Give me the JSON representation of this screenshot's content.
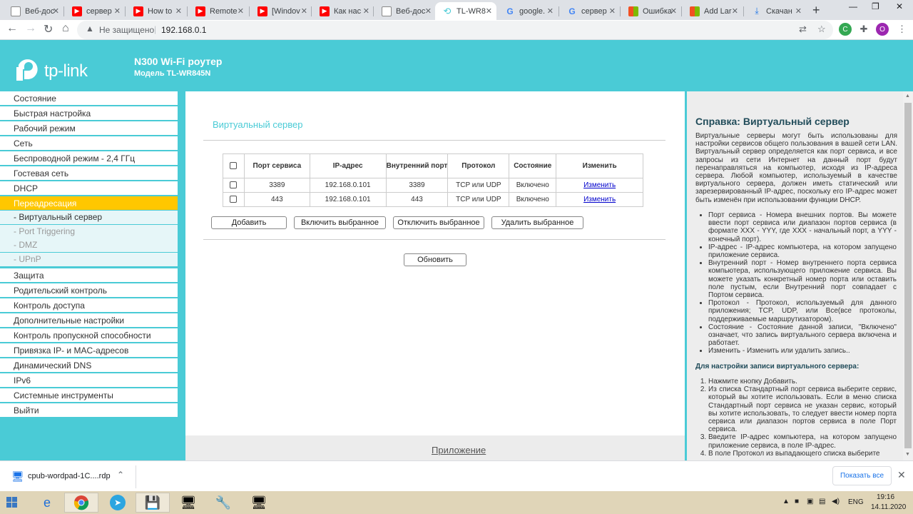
{
  "browser": {
    "tabs": [
      {
        "title": "Веб-дос",
        "icon": "edge-icon"
      },
      {
        "title": "сервер",
        "icon": "youtube-icon"
      },
      {
        "title": "How to",
        "icon": "youtube-icon"
      },
      {
        "title": "Remote",
        "icon": "youtube-icon"
      },
      {
        "title": "[Windov",
        "icon": "youtube-icon"
      },
      {
        "title": "Как нас",
        "icon": "youtube-icon"
      },
      {
        "title": "Веб-дос",
        "icon": "edge-icon"
      },
      {
        "title": "TL-WR8",
        "icon": "tplink-icon"
      },
      {
        "title": "google.",
        "icon": "google-icon"
      },
      {
        "title": "сервер",
        "icon": "google-icon"
      },
      {
        "title": "Ошибка",
        "icon": "microsoft-icon"
      },
      {
        "title": "Add Lar",
        "icon": "microsoft-icon"
      },
      {
        "title": "Скачан",
        "icon": "download-icon"
      }
    ],
    "security_label": "Не защищено",
    "url": "192.168.0.1",
    "profile_initial": "O"
  },
  "router": {
    "logo_text": "tp-link",
    "product_title": "N300 Wi-Fi роутер",
    "model_subtitle": "Модель TL-WR845N"
  },
  "menu": [
    {
      "label": "Состояние"
    },
    {
      "label": "Быстрая настройка"
    },
    {
      "label": "Рабочий режим"
    },
    {
      "label": "Сеть"
    },
    {
      "label": "Беспроводной режим - 2,4 ГГц"
    },
    {
      "label": "Гостевая сеть"
    },
    {
      "label": "DHCP"
    },
    {
      "label": "Переадресация"
    }
  ],
  "submenu": [
    {
      "label": "- Виртуальный сервер"
    },
    {
      "label": "- Port Triggering"
    },
    {
      "label": "- DMZ"
    },
    {
      "label": "- UPnP"
    }
  ],
  "menu_after": [
    {
      "label": "Защита"
    },
    {
      "label": "Родительский контроль"
    },
    {
      "label": "Контроль доступа"
    },
    {
      "label": "Дополнительные настройки маршрутизации"
    },
    {
      "label": "Контроль пропускной способности"
    },
    {
      "label": "Привязка IP- и MAC-адресов"
    },
    {
      "label": "Динамический DNS"
    },
    {
      "label": "IPv6"
    },
    {
      "label": "Системные инструменты"
    },
    {
      "label": "Выйти"
    }
  ],
  "main": {
    "title": "Виртуальный сервер",
    "table": {
      "headers": [
        "Порт сервиса",
        "IP-адрес",
        "Внутренний порт",
        "Протокол",
        "Состояние",
        "Изменить"
      ],
      "rows": [
        {
          "service_port": "3389",
          "ip": "192.168.0.101",
          "internal_port": "3389",
          "protocol": "TCP или UDP",
          "status": "Включено",
          "edit": "Изменить"
        },
        {
          "service_port": "443",
          "ip": "192.168.0.101",
          "internal_port": "443",
          "protocol": "TCP или UDP",
          "status": "Включено",
          "edit": "Изменить"
        }
      ]
    },
    "buttons": {
      "add": "Добавить",
      "enable_selected": "Включить выбранное",
      "disable_selected": "Отключить выбранное",
      "delete_selected": "Удалить выбранное",
      "refresh": "Обновить"
    },
    "app_link": "Приложение"
  },
  "help": {
    "title": "Справка: Виртуальный сервер",
    "intro": "Виртуальные серверы могут быть использованы для настройки сервисов общего пользования в вашей сети LAN. Виртуальный сервер определяется как порт сервиса, и все запросы из сети Интернет на данный порт будут перенаправляться на компьютер, исходя из IP-адреса сервера. Любой компьютер, используемый в качестве виртуального сервера, должен иметь статический или зарезервированный IP-адрес, поскольку его IP-адрес может быть изменён при использовании функции DHCP.",
    "bullets": [
      "Порт сервиса - Номера внешних портов. Вы можете ввести порт сервиса или диапазон портов сервиса (в формате XXX - YYY, где XXX - начальный порт, а YYY - конечный порт).",
      "IP-адрес - IP-адрес компьютера, на котором запущено приложение сервиса.",
      "Внутренний порт - Номер внутреннего порта сервиса компьютера, использующего приложение сервиса. Вы можете указать конкретный номер порта или оставить поле пустым, если Внутренний порт совпадает с Портом сервиса.",
      "Протокол - Протокол, используемый для данного приложения; TCP, UDP, или Все(все протоколы, поддерживаемые маршрутизатором).",
      "Состояние - Состояние данной записи, \"Включено\" означает, что запись виртуального сервера включена и работает.",
      "Изменить - Изменить или удалить запись.."
    ],
    "subtitle": "Для настройки записи виртуального сервера:",
    "steps": [
      "Нажмите кнопку Добавить.",
      "Из списка Стандартный порт сервиса выберите сервис, который вы хотите использовать. Если в меню списка Стандартный порт сервиса не указан сервис, который вы хотите использовать, то следует ввести номер порта сервиса или диапазон портов сервиса в поле Порт сервиса.",
      "Введите IP-адрес компьютера, на котором запущено приложение сервиса, в поле IP-адрес.",
      "В поле Протокол из выпадающего списка выберите"
    ]
  },
  "downloads": {
    "file": "cpub-wordpad-1C....rdp",
    "show_all": "Показать все"
  },
  "taskbar": {
    "lang": "ENG",
    "time": "19:16",
    "date": "14.11.2020"
  }
}
